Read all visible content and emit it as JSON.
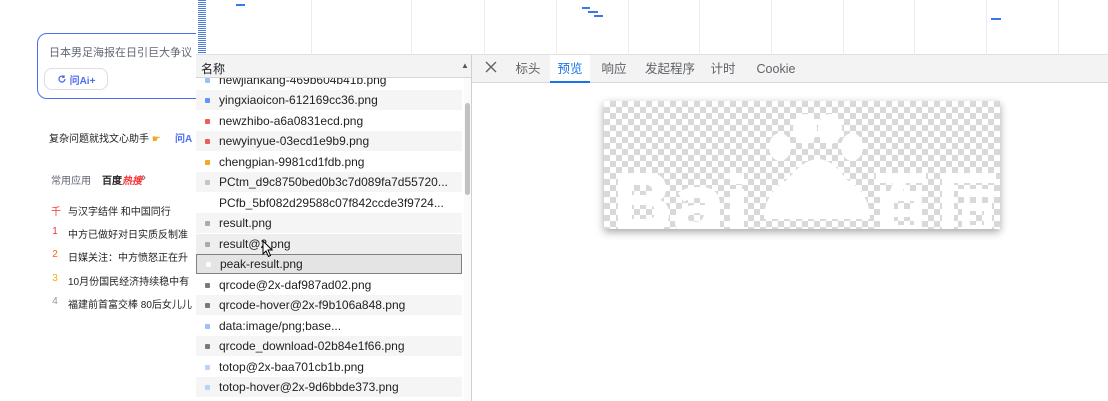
{
  "left_page": {
    "search_placeholder": "日本男足海报在日引巨大争议",
    "ai_button_label": "问Ai+",
    "assist_promo": "复杂问题就找文心助手",
    "assist_link": "问A",
    "tabs": {
      "common": "常用应用",
      "hot_prefix": "百度",
      "hot_accent": "热搜"
    },
    "hot_items": [
      {
        "index": "千",
        "text": "与汉字结伴 和中国同行",
        "color": "#f73131"
      },
      {
        "index": "1",
        "text": "中方已做好对日实质反制准",
        "color": "#f73131"
      },
      {
        "index": "2",
        "text": "日媒关注：中方愤怒正在升",
        "color": "#ff6600"
      },
      {
        "index": "3",
        "text": "10月份国民经济持续稳中有",
        "color": "#faa90e"
      },
      {
        "index": "4",
        "text": "福建前首富交棒 80后女儿儿",
        "color": "#9195a3"
      }
    ]
  },
  "network": {
    "header_label": "名称",
    "rows": [
      {
        "name": "newjiankang-469b604b41b.png",
        "icon_color": "#8ab4f8"
      },
      {
        "name": "yingxiaoicon-612169cc36.png",
        "icon_color": "#4285f4"
      },
      {
        "name": "newzhibo-a6a0831ecd.png",
        "icon_color": "#ea4335"
      },
      {
        "name": "newyinyue-03ecd1e9b9.png",
        "icon_color": "#e8453c"
      },
      {
        "name": "chengpian-9981cd1fdb.png",
        "icon_color": "#f29900"
      },
      {
        "name": "PCtm_d9c8750bed0b3c7d089fa7d55720...",
        "icon_color": "#bdbdbd"
      },
      {
        "name": "PCfb_5bf082d29588c07f842ccde3f9724...",
        "icon_color": "#ffffff"
      },
      {
        "name": "result.png",
        "icon_color": "#9e9e9e"
      },
      {
        "name": "result@2.png",
        "icon_color": "#9e9e9e"
      },
      {
        "name": "peak-result.png",
        "icon_color": "#ffffff"
      },
      {
        "name": "qrcode@2x-daf987ad02.png",
        "icon_color": "#5f6368"
      },
      {
        "name": "qrcode-hover@2x-f9b106a848.png",
        "icon_color": "#5f6368"
      },
      {
        "name": "data:image/png;base...",
        "icon_color": "#8ab4f8"
      },
      {
        "name": "qrcode_download-02b84e1f66.png",
        "icon_color": "#5f6368"
      },
      {
        "name": "totop@2x-baa701cb1b.png",
        "icon_color": "#aecbfa"
      },
      {
        "name": "totop-hover@2x-9d6bbde373.png",
        "icon_color": "#aecbfa"
      }
    ]
  },
  "detail": {
    "tabs": [
      {
        "label": "标头",
        "active": false
      },
      {
        "label": "预览",
        "active": true
      },
      {
        "label": "响应",
        "active": false
      },
      {
        "label": "发起程序",
        "active": false
      },
      {
        "label": "计时",
        "active": false
      },
      {
        "label": "Cookie",
        "active": false
      }
    ]
  },
  "colors": {
    "accent": "#1a73e8",
    "baidu_blue": "#4e6ef2",
    "hot_red": "#f73131"
  }
}
